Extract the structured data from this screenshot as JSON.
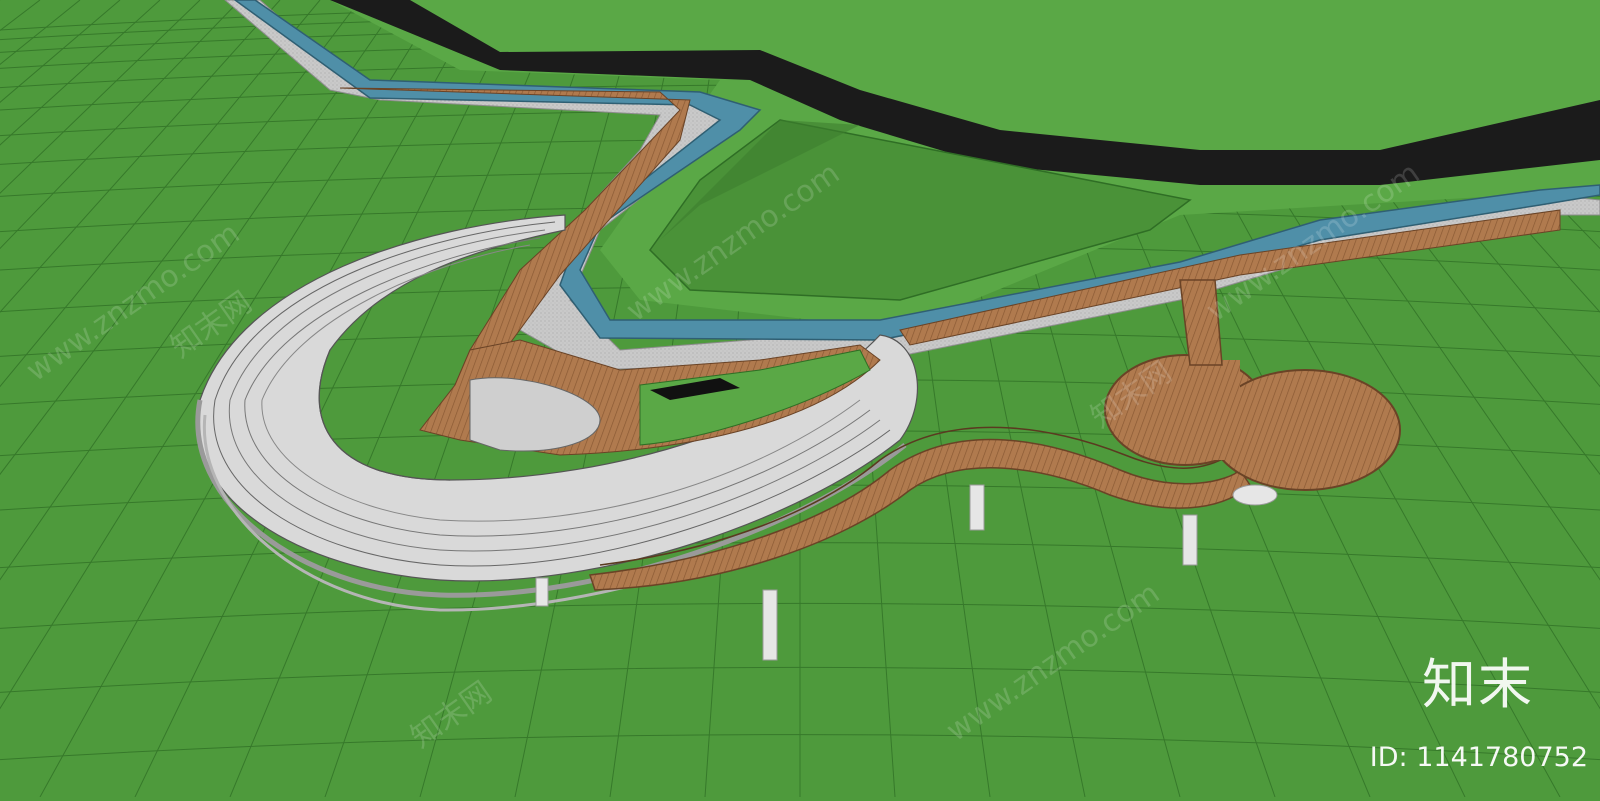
{
  "watermark": {
    "site_text": "www.znzmo.com",
    "brand_text": "知末网",
    "logo_text": "知末",
    "id_text": "ID: 1141780752"
  },
  "colors": {
    "grass": "#4e9a3c",
    "grass_light": "#5aa846",
    "grid_line": "#2f6e25",
    "road": "#1b1b1b",
    "water": "#4f8fa8",
    "paving": "#c8c8c8",
    "wood": "#b07a4e",
    "wood_dark": "#7a4e2c",
    "column": "#e6e6e6"
  }
}
